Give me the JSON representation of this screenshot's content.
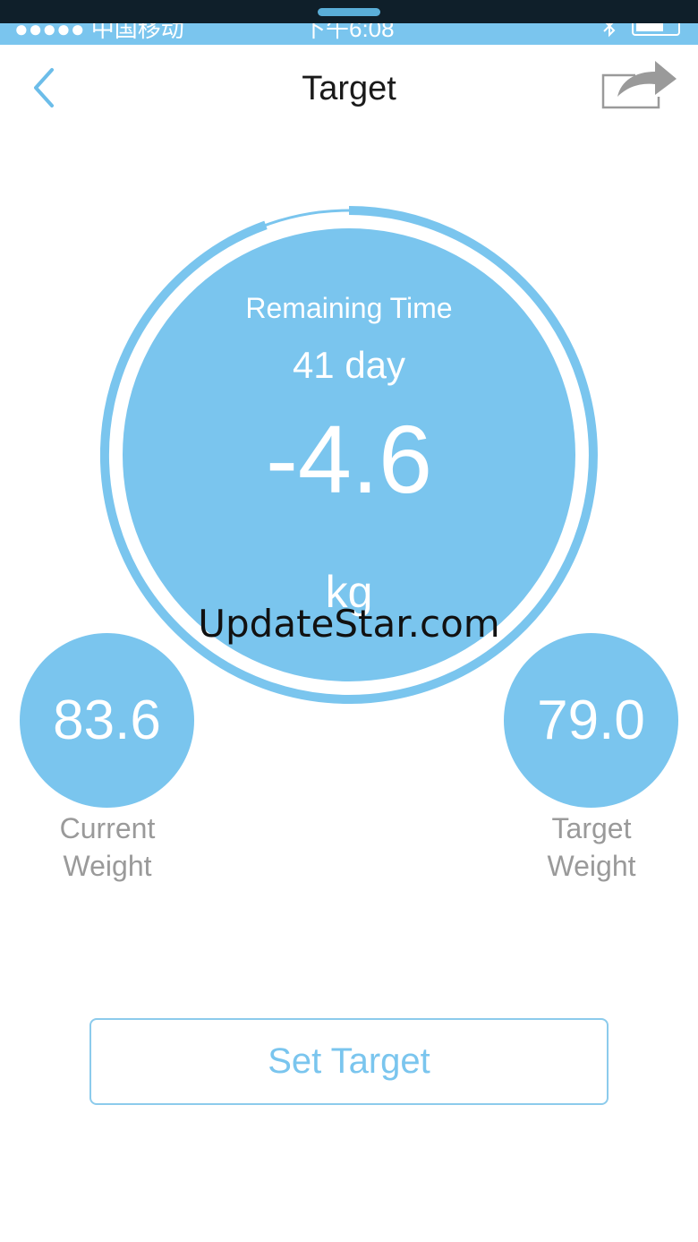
{
  "status_bar": {
    "carrier": "●●●●● 中国移动",
    "time": "下午6:08",
    "bluetooth_icon": "bluetooth-icon",
    "battery_icon": "battery-icon"
  },
  "nav": {
    "title": "Target",
    "back_icon": "chevron-left-icon",
    "share_icon": "share-arrow-icon"
  },
  "main": {
    "remaining_label": "Remaining Time",
    "days": "41 day",
    "difference": "-4.6",
    "unit": "kg",
    "watermark": "UpdateStar.com"
  },
  "current_weight": {
    "value": "83.6",
    "label_line1": "Current",
    "label_line2": "Weight"
  },
  "target_weight": {
    "value": "79.0",
    "label_line1": "Target",
    "label_line2": "Weight"
  },
  "set_target_button": {
    "label": "Set Target"
  },
  "colors": {
    "accent": "#7ac5ee",
    "text_gray": "#9a9a9a",
    "title_text": "#1a1a1a"
  }
}
